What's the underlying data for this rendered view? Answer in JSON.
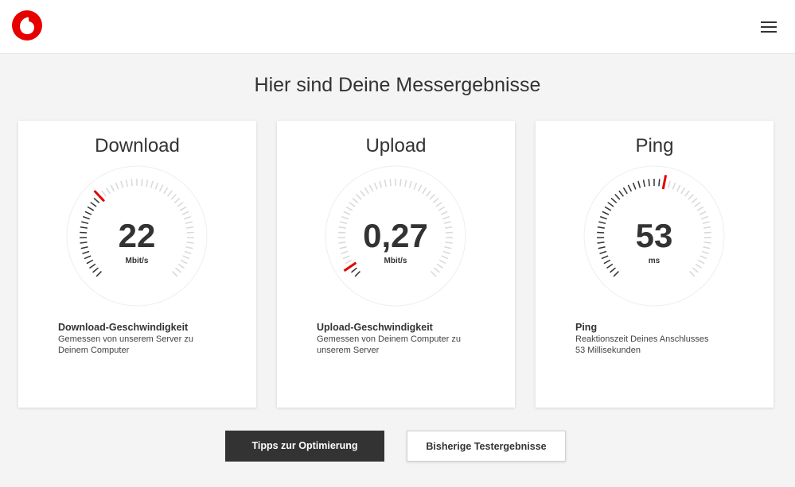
{
  "header": {
    "logo_icon": "vodafone-logo",
    "menu_icon": "hamburger-menu-icon"
  },
  "page_title": "Hier sind Deine Messergebnisse",
  "colors": {
    "accent": "#e60000",
    "dark": "#333333",
    "tick_inactive": "#d8d8d8",
    "tick_active": "#333333"
  },
  "cards": [
    {
      "title": "Download",
      "value": "22",
      "unit": "Mbit/s",
      "level": 0.33,
      "label": "Download-Geschwindigkeit",
      "desc": [
        "Gemessen von unserem Server zu",
        "Deinem Computer"
      ]
    },
    {
      "title": "Upload",
      "value": "0,27",
      "unit": "Mbit/s",
      "level": 0.03,
      "label": "Upload-Geschwindigkeit",
      "desc": [
        "Gemessen von Deinem Computer zu",
        "unserem Server"
      ]
    },
    {
      "title": "Ping",
      "value": "53",
      "unit": "ms",
      "level": 0.53,
      "label": "Ping",
      "desc": [
        "Reaktionszeit Deines Anschlusses",
        "53 Millisekunden"
      ]
    }
  ],
  "buttons": {
    "tips": "Tipps zur Optimierung",
    "history": "Bisherige Testergebnisse"
  }
}
